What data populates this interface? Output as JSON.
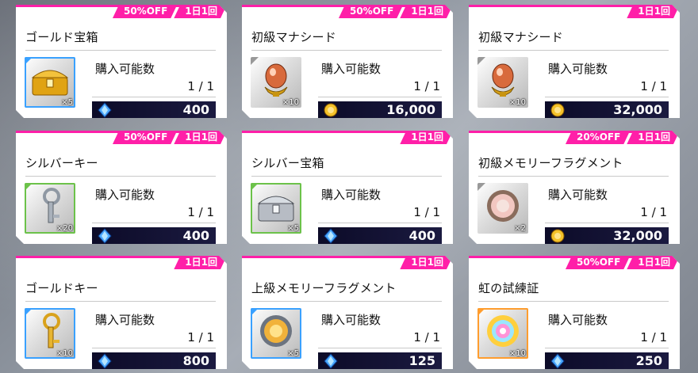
{
  "tags": {
    "daily": "1日1回"
  },
  "labels": {
    "purchasable": "購入可能数"
  },
  "colors": {
    "accent": "#ff1fa8",
    "price_bg": "#0c0b28"
  },
  "items": [
    {
      "name": "ゴールド宝箱",
      "discount": "50%OFF",
      "stock": "1 / 1",
      "price": "400",
      "qty": "×5",
      "currency": "blue-gem-icon",
      "icon": "gold-chest-icon",
      "rarity": "blue"
    },
    {
      "name": "初級マナシード",
      "discount": "50%OFF",
      "stock": "1 / 1",
      "price": "16,000",
      "qty": "×10",
      "currency": "gold-coin-icon",
      "icon": "mana-seed-icon",
      "rarity": "gray"
    },
    {
      "name": "初級マナシード",
      "discount": "",
      "stock": "1 / 1",
      "price": "32,000",
      "qty": "×10",
      "currency": "gold-coin-icon",
      "icon": "mana-seed-icon",
      "rarity": "gray"
    },
    {
      "name": "シルバーキー",
      "discount": "50%OFF",
      "stock": "1 / 1",
      "price": "400",
      "qty": "×20",
      "currency": "blue-gem-icon",
      "icon": "silver-key-icon",
      "rarity": "green"
    },
    {
      "name": "シルバー宝箱",
      "discount": "",
      "stock": "1 / 1",
      "price": "400",
      "qty": "×5",
      "currency": "blue-gem-icon",
      "icon": "silver-chest-icon",
      "rarity": "green"
    },
    {
      "name": "初級メモリーフラグメント",
      "discount": "20%OFF",
      "stock": "1 / 1",
      "price": "32,000",
      "qty": "×2",
      "currency": "gold-coin-icon",
      "icon": "memory-fragment-icon",
      "rarity": "gray"
    },
    {
      "name": "ゴールドキー",
      "discount": "",
      "stock": "1 / 1",
      "price": "800",
      "qty": "×10",
      "currency": "blue-gem-icon",
      "icon": "gold-key-icon",
      "rarity": "blue"
    },
    {
      "name": "上級メモリーフラグメント",
      "discount": "",
      "stock": "1 / 1",
      "price": "125",
      "qty": "×5",
      "currency": "blue-gem-icon",
      "icon": "advanced-memory-fragment-icon",
      "rarity": "blue"
    },
    {
      "name": "虹の試練証",
      "discount": "50%OFF",
      "stock": "1 / 1",
      "price": "250",
      "qty": "×10",
      "currency": "blue-gem-icon",
      "icon": "rainbow-trial-proof-icon",
      "rarity": "orange"
    }
  ]
}
